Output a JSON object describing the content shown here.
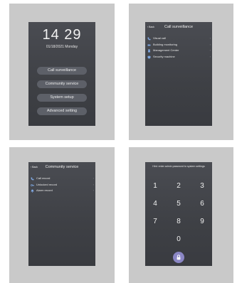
{
  "home": {
    "time": "14 29",
    "date": "01/18/2021 Monday",
    "menu": [
      "Call surveillance",
      "Community service",
      "System setup",
      "Advanced setting"
    ]
  },
  "call_surveillance": {
    "back": "‹ Back",
    "title": "Call surveillance",
    "items": [
      {
        "label": "Visual call",
        "icon": "phone-icon"
      },
      {
        "label": "Building monitoring",
        "icon": "camera-icon"
      },
      {
        "label": "Management Center",
        "icon": "building-icon"
      },
      {
        "label": "Security machine",
        "icon": "shield-icon"
      }
    ]
  },
  "community_service": {
    "back": "‹ Back",
    "title": "Community service",
    "items": [
      {
        "label": "Call record",
        "icon": "phone-icon"
      },
      {
        "label": "Unlocked record",
        "icon": "key-icon"
      },
      {
        "label": "Alarm record",
        "icon": "bell-icon"
      }
    ]
  },
  "keypad": {
    "hint": "Hint: enter admin password to system settings",
    "keys": [
      "1",
      "2",
      "3",
      "4",
      "5",
      "6",
      "7",
      "8",
      "9",
      "0"
    ],
    "unlock_icon": "lock-icon",
    "accent": "#8a86c4"
  }
}
